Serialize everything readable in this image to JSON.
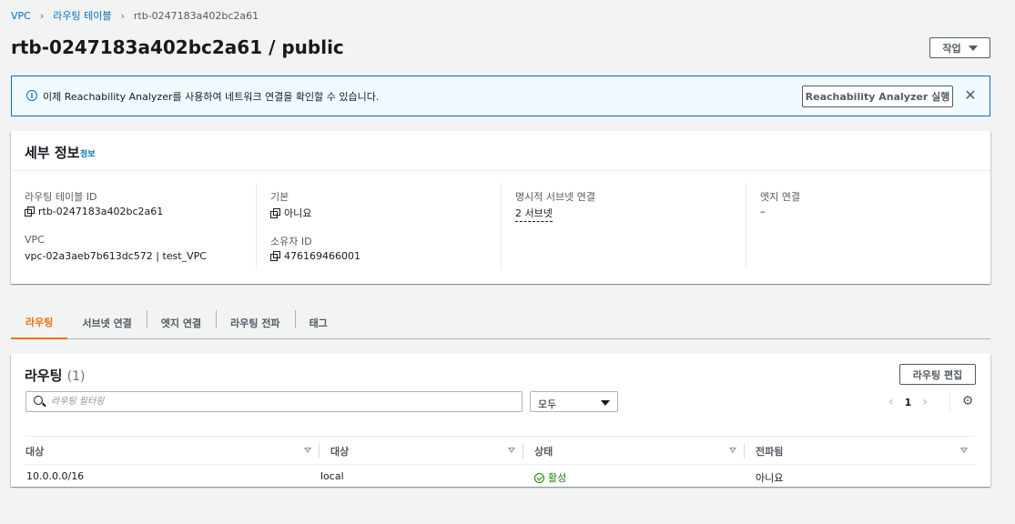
{
  "breadcrumb": [
    {
      "label": "VPC"
    },
    {
      "label": "라우팅 테이블"
    },
    {
      "label": "rtb-0247183a402bc2a61"
    }
  ],
  "page": {
    "title": "rtb-0247183a402bc2a61 / public",
    "actions_label": "작업"
  },
  "banner": {
    "text": "이제 Reachability Analyzer를 사용하여 네트워크 연결을 확인할 수 있습니다.",
    "button_label": "Reachability Analyzer 실행",
    "close_label": "✕"
  },
  "details": {
    "title": "세부 정보",
    "info_link": "정보",
    "fields": {
      "route_table_id": {
        "label": "라우팅 테이블 ID",
        "value": "rtb-0247183a402bc2a61"
      },
      "vpc": {
        "label": "VPC",
        "value": "vpc-02a3aeb7b613dc572 | test_VPC"
      },
      "main": {
        "label": "기본",
        "value": "아니요"
      },
      "owner_id": {
        "label": "소유자 ID",
        "value": "476169466001"
      },
      "explicit_subnet": {
        "label": "명시적 서브넷 연결",
        "value": "2 서브넷"
      },
      "edge": {
        "label": "엣지 연결",
        "value": "–"
      }
    }
  },
  "tabs": [
    {
      "label": "라우팅",
      "active": true
    },
    {
      "label": "서브넷 연결"
    },
    {
      "label": "엣지 연결"
    },
    {
      "label": "라우팅 전파"
    },
    {
      "label": "태그"
    }
  ],
  "routes": {
    "title": "라우팅",
    "count": "(1)",
    "edit_label": "라우팅 편집",
    "filter_placeholder": "라우팅 필터링",
    "select_value": "모두",
    "page_number": "1",
    "prev": "‹",
    "next": "›",
    "gear": "⚙",
    "columns": [
      "대상",
      "대상",
      "상태",
      "전파됨"
    ],
    "rows": [
      {
        "destination": "10.0.0.0/16",
        "target": "local",
        "status": "활성",
        "propagated": "아니요"
      }
    ],
    "status_color": "#1d8102"
  },
  "colors": {
    "accent": "#ec7211",
    "link": "#0073bb",
    "banner_bg": "#f1faff"
  }
}
